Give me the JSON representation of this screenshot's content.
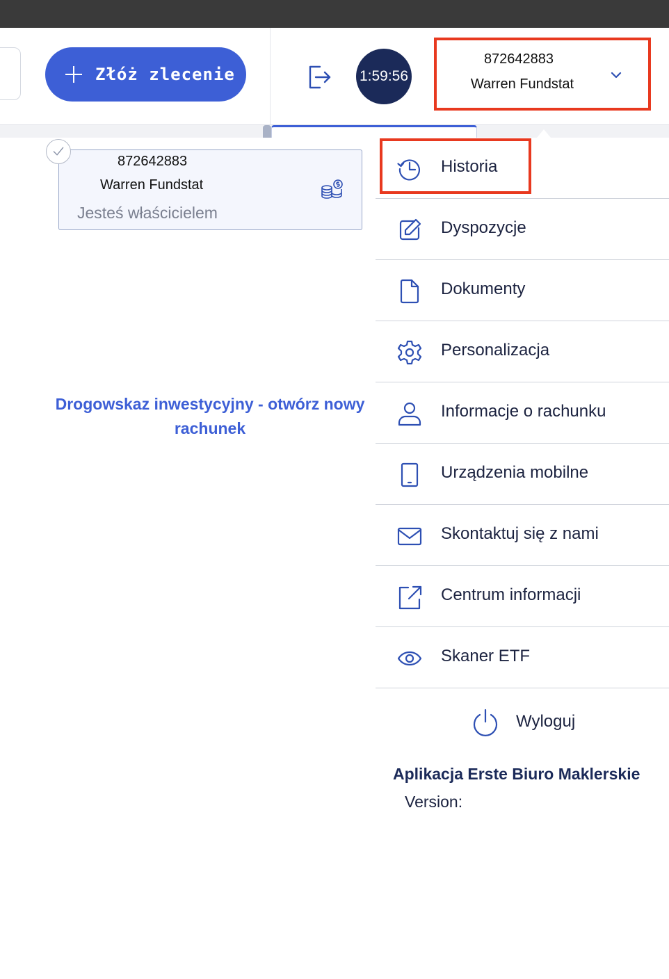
{
  "header": {
    "order_button_label": "Złóż zlecenie",
    "timer": "1:59:56",
    "account_number": "872642883",
    "account_name": "Warren Fundstat"
  },
  "account_card": {
    "number": "872642883",
    "name": "Warren Fundstat",
    "role": "Jesteś właścicielem"
  },
  "guide_link": "Drogowskaz inwestycyjny - otwórz nowy rachunek",
  "menu": {
    "items": [
      {
        "label": "Historia",
        "icon": "history-icon"
      },
      {
        "label": "Dyspozycje",
        "icon": "edit-document-icon"
      },
      {
        "label": "Dokumenty",
        "icon": "document-icon"
      },
      {
        "label": "Personalizacja",
        "icon": "gear-icon"
      },
      {
        "label": "Informacje o rachunku",
        "icon": "user-icon"
      },
      {
        "label": "Urządzenia mobilne",
        "icon": "mobile-device-icon"
      },
      {
        "label": "Skontaktuj się z nami",
        "icon": "envelope-icon"
      },
      {
        "label": "Centrum informacji",
        "icon": "external-link-icon"
      },
      {
        "label": "Skaner ETF",
        "icon": "eye-icon"
      }
    ],
    "logout_label": "Wyloguj",
    "app_name": "Aplikacja Erste Biuro Maklerskie",
    "version_label": "Version:"
  },
  "colors": {
    "primary": "#3d5fd6",
    "navy": "#1b2a59",
    "highlight": "#e8391f",
    "icon": "#2d4fb3"
  }
}
